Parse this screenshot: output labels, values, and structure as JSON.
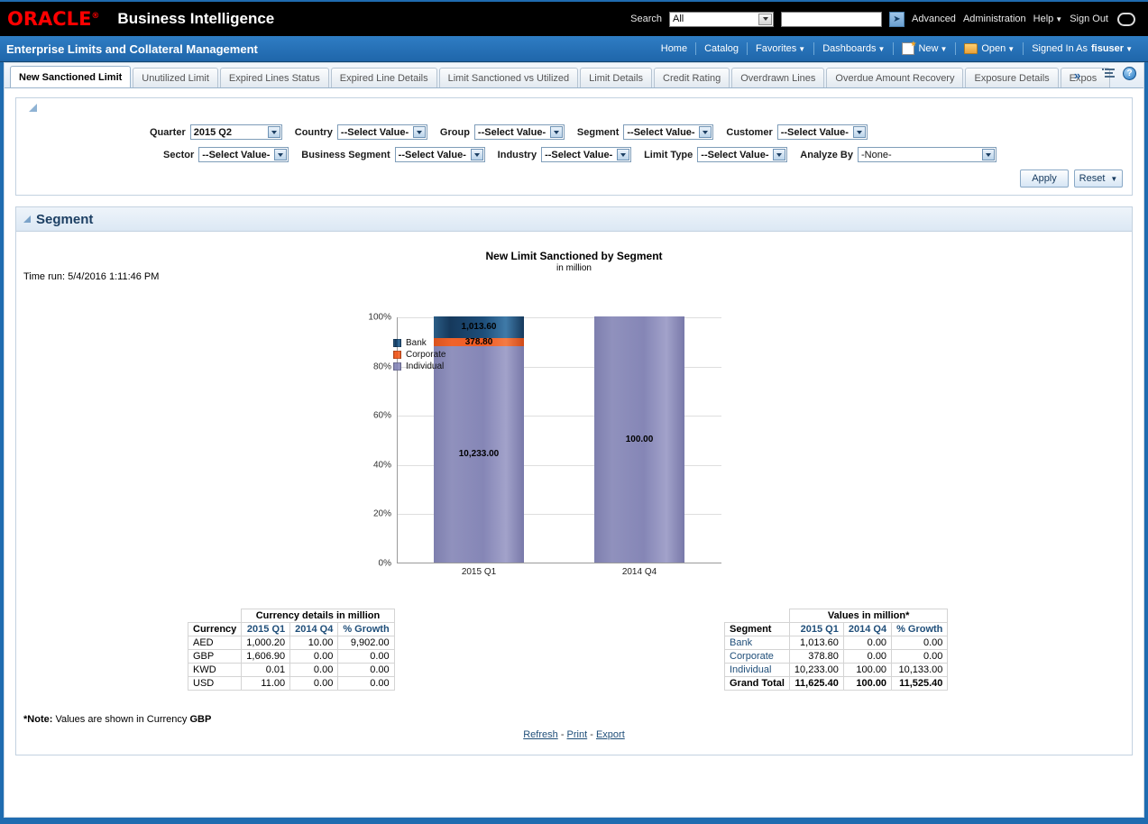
{
  "brand": {
    "logo": "ORACLE",
    "product": "Business Intelligence"
  },
  "header": {
    "search_label": "Search",
    "search_scope": "All",
    "search_placeholder": "",
    "search_value": "",
    "go_icon": "arrow-right-icon",
    "links": [
      "Advanced",
      "Administration",
      "Help",
      "Sign Out"
    ]
  },
  "appbar": {
    "title": "Enterprise Limits and Collateral Management",
    "nav": [
      "Home",
      "Catalog",
      "Favorites",
      "Dashboards",
      "New",
      "Open"
    ],
    "signed_in_label": "Signed In As",
    "signed_in_user": "fisuser"
  },
  "tabs": [
    {
      "label": "New Sanctioned Limit",
      "active": true
    },
    {
      "label": "Unutilized Limit",
      "active": false
    },
    {
      "label": "Expired Lines Status",
      "active": false
    },
    {
      "label": "Expired Line Details",
      "active": false
    },
    {
      "label": "Limit Sanctioned vs Utilized",
      "active": false
    },
    {
      "label": "Limit Details",
      "active": false
    },
    {
      "label": "Credit Rating",
      "active": false
    },
    {
      "label": "Overdrawn Lines",
      "active": false
    },
    {
      "label": "Overdue Amount Recovery",
      "active": false
    },
    {
      "label": "Exposure Details",
      "active": false
    },
    {
      "label": "Expos",
      "active": false
    }
  ],
  "tabs_overflow": "»",
  "tabstrip_tools": {
    "page_options": "page-options-icon",
    "help": "?"
  },
  "prompts": {
    "row1": [
      {
        "label": "Quarter",
        "value": "2015 Q2",
        "width": "q"
      },
      {
        "label": "Country",
        "value": "--Select Value-",
        "width": "sv"
      },
      {
        "label": "Group",
        "value": "--Select Value-",
        "width": "sv"
      },
      {
        "label": "Segment",
        "value": "--Select Value-",
        "width": "sv"
      },
      {
        "label": "Customer",
        "value": "--Select Value-",
        "width": "sv"
      }
    ],
    "row2": [
      {
        "label": "Sector",
        "value": "--Select Value-",
        "width": "sv"
      },
      {
        "label": "Business Segment",
        "value": "--Select Value-",
        "width": "sv"
      },
      {
        "label": "Industry",
        "value": "--Select Value-",
        "width": "sv"
      },
      {
        "label": "Limit Type",
        "value": "--Select Value-",
        "width": "sv"
      },
      {
        "label": "Analyze By",
        "value": "-None-",
        "width": "an"
      }
    ],
    "apply_label": "Apply",
    "reset_label": "Reset"
  },
  "section": {
    "title": "Segment",
    "time_run": "Time run: 5/4/2016 1:11:46 PM",
    "note_prefix": "*Note:",
    "note_text": "Values are shown in Currency",
    "note_currency": "GBP",
    "links": {
      "refresh": "Refresh",
      "print": "Print",
      "export": "Export",
      "sep": "-"
    }
  },
  "chart_data": {
    "type": "bar",
    "stacked": true,
    "normalized": true,
    "title": "New Limit Sanctioned by Segment",
    "subtitle": "in million",
    "xlabel": "",
    "ylabel": "",
    "ylim": [
      0,
      100
    ],
    "ytick_labels": [
      "100%",
      "80%",
      "60%",
      "40%",
      "20%",
      "0%"
    ],
    "grid": true,
    "legend_position": "right",
    "categories": [
      "2015 Q1",
      "2014 Q4"
    ],
    "series": [
      {
        "name": "Bank",
        "color": "#1d4e7a",
        "values": [
          1013.6,
          0.0
        ],
        "labels": [
          "1,013.60",
          ""
        ]
      },
      {
        "name": "Corporate",
        "color": "#ef5a22",
        "values": [
          378.8,
          0.0
        ],
        "labels": [
          "378.80",
          ""
        ]
      },
      {
        "name": "Individual",
        "color": "#8586b6",
        "values": [
          10233.0,
          100.0
        ],
        "labels": [
          "10,233.00",
          "100.00"
        ]
      }
    ],
    "totals": [
      11625.4,
      100.0
    ]
  },
  "currency_table": {
    "group_header": "Currency details in million",
    "columns": [
      "Currency",
      "2015 Q1",
      "2014 Q4",
      "% Growth"
    ],
    "rows": [
      [
        "AED",
        "1,000.20",
        "10.00",
        "9,902.00"
      ],
      [
        "GBP",
        "1,606.90",
        "0.00",
        "0.00"
      ],
      [
        "KWD",
        "0.01",
        "0.00",
        "0.00"
      ],
      [
        "USD",
        "11.00",
        "0.00",
        "0.00"
      ]
    ]
  },
  "values_table": {
    "group_header": "Values in million*",
    "columns": [
      "Segment",
      "2015 Q1",
      "2014 Q4",
      "% Growth"
    ],
    "rows": [
      [
        "Bank",
        "1,013.60",
        "0.00",
        "0.00"
      ],
      [
        "Corporate",
        "378.80",
        "0.00",
        "0.00"
      ],
      [
        "Individual",
        "10,233.00",
        "100.00",
        "10,133.00"
      ]
    ],
    "total_row": [
      "Grand Total",
      "11,625.40",
      "100.00",
      "11,525.40"
    ]
  }
}
